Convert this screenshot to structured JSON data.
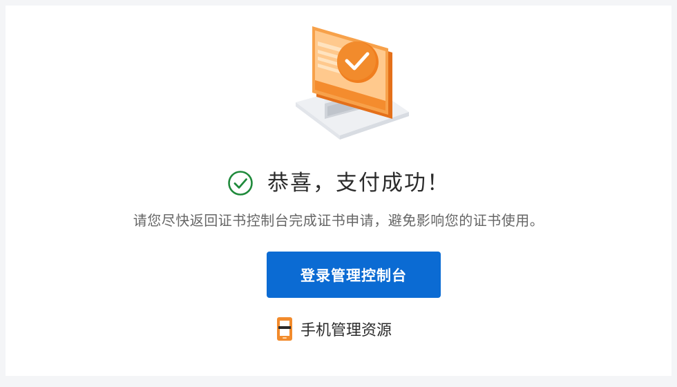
{
  "result": {
    "icon": "check-circle-icon",
    "title": "恭喜，支付成功！",
    "subtitle": "请您尽快返回证书控制台完成证书申请，避免影响您的证书使用。",
    "accent_color": "#1f8a3b"
  },
  "illustration": {
    "icon": "monitor-certificate-check-illustration",
    "colors": {
      "orange": "#f28b2c",
      "orange_light": "#ffd7a8",
      "orange_dark": "#e4701a",
      "gray": "#d9dde3"
    }
  },
  "actions": {
    "primary_label": "登录管理控制台",
    "primary_color": "#0b6bd3",
    "secondary_icon": "mobile-phone-icon",
    "secondary_label": "手机管理资源"
  }
}
